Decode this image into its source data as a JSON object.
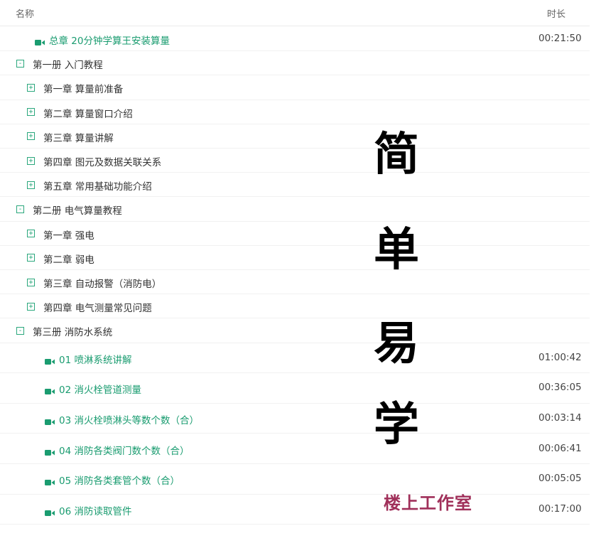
{
  "header": {
    "name_col": "名称",
    "duration_col": "时长"
  },
  "rows": [
    {
      "type": "video",
      "level": 0,
      "label": "总章 20分钟学算王安装算量",
      "duration": "00:21:50"
    },
    {
      "type": "folder",
      "level": 0,
      "state": "expanded",
      "label": "第一册 入门教程"
    },
    {
      "type": "folder",
      "level": 1,
      "state": "collapsed",
      "label": "第一章 算量前准备"
    },
    {
      "type": "folder",
      "level": 1,
      "state": "collapsed",
      "label": "第二章 算量窗口介绍"
    },
    {
      "type": "folder",
      "level": 1,
      "state": "collapsed",
      "label": "第三章 算量讲解"
    },
    {
      "type": "folder",
      "level": 1,
      "state": "collapsed",
      "label": "第四章 图元及数据关联关系"
    },
    {
      "type": "folder",
      "level": 1,
      "state": "collapsed",
      "label": "第五章 常用基础功能介绍"
    },
    {
      "type": "folder",
      "level": 0,
      "state": "expanded",
      "label": "第二册 电气算量教程"
    },
    {
      "type": "folder",
      "level": 1,
      "state": "collapsed",
      "label": "第一章 强电"
    },
    {
      "type": "folder",
      "level": 1,
      "state": "collapsed",
      "label": "第二章 弱电"
    },
    {
      "type": "folder",
      "level": 1,
      "state": "collapsed",
      "label": "第三章 自动报警（消防电）"
    },
    {
      "type": "folder",
      "level": 1,
      "state": "collapsed",
      "label": "第四章 电气测量常见问题"
    },
    {
      "type": "folder",
      "level": 0,
      "state": "expanded",
      "label": "第三册 消防水系统"
    },
    {
      "type": "video",
      "level": 1,
      "label": "01 喷淋系统讲解",
      "duration": "01:00:42"
    },
    {
      "type": "video",
      "level": 1,
      "label": "02 消火栓管道测量",
      "duration": "00:36:05"
    },
    {
      "type": "video",
      "level": 1,
      "label": "03 消火栓喷淋头等数个数（合）",
      "duration": "00:03:14"
    },
    {
      "type": "video",
      "level": 1,
      "label": "04 消防各类阀门数个数（合）",
      "duration": "00:06:41"
    },
    {
      "type": "video",
      "level": 1,
      "label": "05 消防各类套管个数（合）",
      "duration": "00:05:05"
    },
    {
      "type": "video",
      "level": 1,
      "label": "06 消防读取管件",
      "duration": "00:17:00"
    }
  ],
  "overlay": {
    "chars": [
      "简",
      "单",
      "易",
      "学"
    ],
    "studio": "楼上工作室"
  },
  "toggle_symbols": {
    "expanded": "-",
    "collapsed": "+"
  },
  "colors": {
    "accent_green": "#1a9c70",
    "toggle_green": "#2aa77c",
    "studio_red": "#a0305a"
  },
  "icons": {
    "video": "video-camera-icon",
    "expanded": "collapse-minus-icon",
    "collapsed": "expand-plus-icon"
  }
}
